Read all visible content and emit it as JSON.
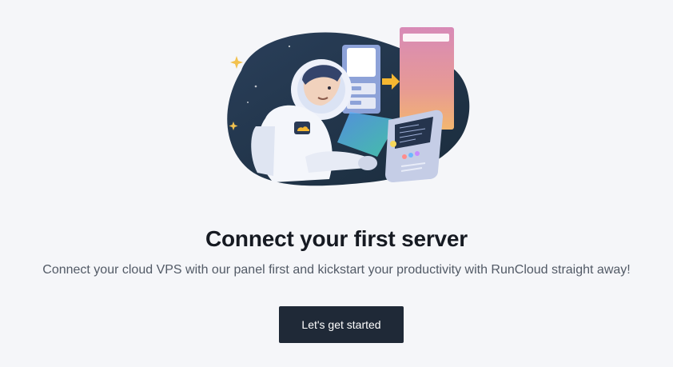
{
  "empty_state": {
    "title": "Connect your first server",
    "description": "Connect your cloud VPS with our panel first and kickstart your productivity with RunCloud straight away!",
    "cta_label": "Let's get started"
  },
  "illustration": {
    "icon": "astronaut-server-illustration-icon"
  },
  "colors": {
    "background": "#f5f6f9",
    "title": "#161a22",
    "description": "#525a66",
    "button": "#1f2937",
    "button_text": "#ffffff",
    "blob": "#1e3448"
  }
}
